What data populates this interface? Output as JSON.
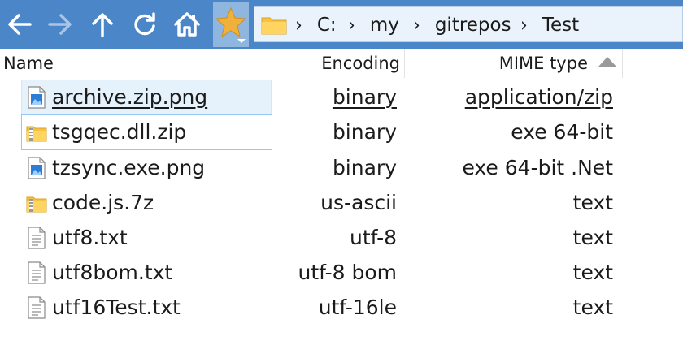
{
  "address": {
    "crumbs": [
      "C:",
      "my",
      "gitrepos",
      "Test"
    ]
  },
  "columns": {
    "name": "Name",
    "encoding": "Encoding",
    "mime": "MIME type"
  },
  "files": [
    {
      "name": "archive.zip.png",
      "encoding": "binary",
      "mime": "application/zip",
      "icon": "image-file-icon"
    },
    {
      "name": "tsgqec.dll.zip",
      "encoding": "binary",
      "mime": "exe 64-bit",
      "icon": "zip-folder-icon"
    },
    {
      "name": "tzsync.exe.png",
      "encoding": "binary",
      "mime": "exe 64-bit .Net",
      "icon": "image-file-icon"
    },
    {
      "name": "code.js.7z",
      "encoding": "us-ascii",
      "mime": "text",
      "icon": "zip-folder-icon"
    },
    {
      "name": "utf8.txt",
      "encoding": "utf-8",
      "mime": "text",
      "icon": "text-file-icon"
    },
    {
      "name": "utf8bom.txt",
      "encoding": "utf-8 bom",
      "mime": "text",
      "icon": "text-file-icon"
    },
    {
      "name": "utf16Test.txt",
      "encoding": "utf-16le",
      "mime": "text",
      "icon": "text-file-icon"
    }
  ],
  "colors": {
    "toolbar": "#4a86c8",
    "address_bg": "#eaf3fc",
    "selection": "#e5f1fb",
    "focus_border": "#99c9ef",
    "folder": "#f5c242",
    "star": "#f0b13c"
  }
}
